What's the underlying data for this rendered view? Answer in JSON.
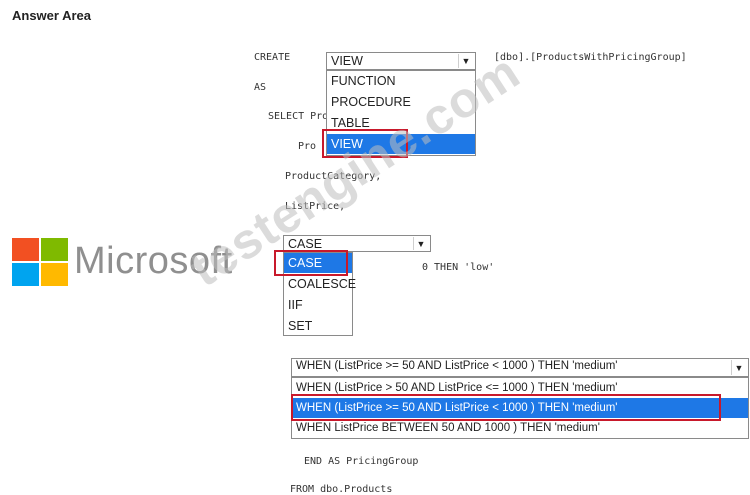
{
  "title": "Answer Area",
  "code": {
    "create": "CREATE",
    "view_name": "[dbo].[ProductsWithPricingGroup]",
    "as": "AS",
    "select": "SELECT",
    "select_frag": "SELECT ProductName,",
    "prod_frag": "Pro",
    "product_category": "ProductCategory,",
    "list_price": "ListPrice,",
    "then_low": "0 THEN 'low'",
    "end_as": "END AS PricingGroup",
    "from": "FROM dbo.Products"
  },
  "dropdown1": {
    "selected": "VIEW",
    "options": [
      "FUNCTION",
      "PROCEDURE",
      "TABLE",
      "VIEW"
    ]
  },
  "dropdown2": {
    "selected": "CASE",
    "options": [
      "CASE",
      "COALESCE",
      "IIF",
      "SET"
    ]
  },
  "dropdown3": {
    "selected": "WHEN (ListPrice >= 50 AND ListPrice < 1000 ) THEN 'medium'",
    "options": [
      "WHEN (ListPrice > 50 AND ListPrice <= 1000 ) THEN 'medium'",
      "WHEN (ListPrice >= 50 AND ListPrice < 1000 ) THEN 'medium'",
      "WHEN ListPrice BETWEEN 50 AND 1000 ) THEN 'medium'"
    ]
  },
  "logo": {
    "text": "Microsoft"
  },
  "watermark": {
    "text": "testengine.com"
  },
  "colors": {
    "highlight": "#1e78e6",
    "answer_box": "#c8192b"
  }
}
